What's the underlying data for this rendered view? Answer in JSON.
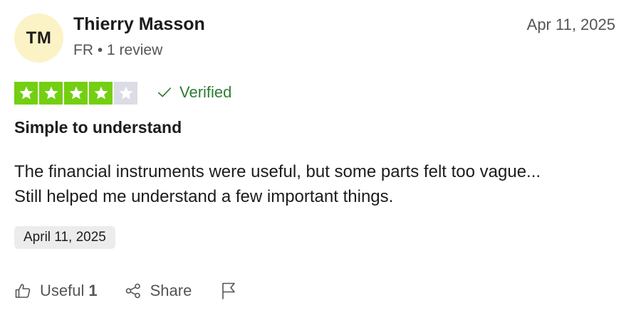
{
  "reviewer": {
    "initials": "TM",
    "name": "Thierry Masson",
    "country": "FR",
    "separator": "•",
    "review_count": "1 review"
  },
  "review": {
    "date_top": "Apr 11, 2025",
    "rating": 4,
    "rating_max": 5,
    "verified_label": "Verified",
    "title": "Simple to understand",
    "body_line1": "The financial instruments were useful, but some parts felt too vague...",
    "body_line2": "Still helped me understand a few important things.",
    "experience_date": "April 11, 2025"
  },
  "actions": {
    "useful_label": "Useful",
    "useful_count": "1",
    "share_label": "Share"
  },
  "colors": {
    "star_filled": "#73cf11",
    "star_empty": "#dcdce6",
    "avatar_bg": "#fbf3c5",
    "verified": "#2e7d32"
  },
  "icons": [
    "star-icon",
    "checkmark-icon",
    "thumbs-up-icon",
    "share-icon",
    "flag-icon"
  ]
}
